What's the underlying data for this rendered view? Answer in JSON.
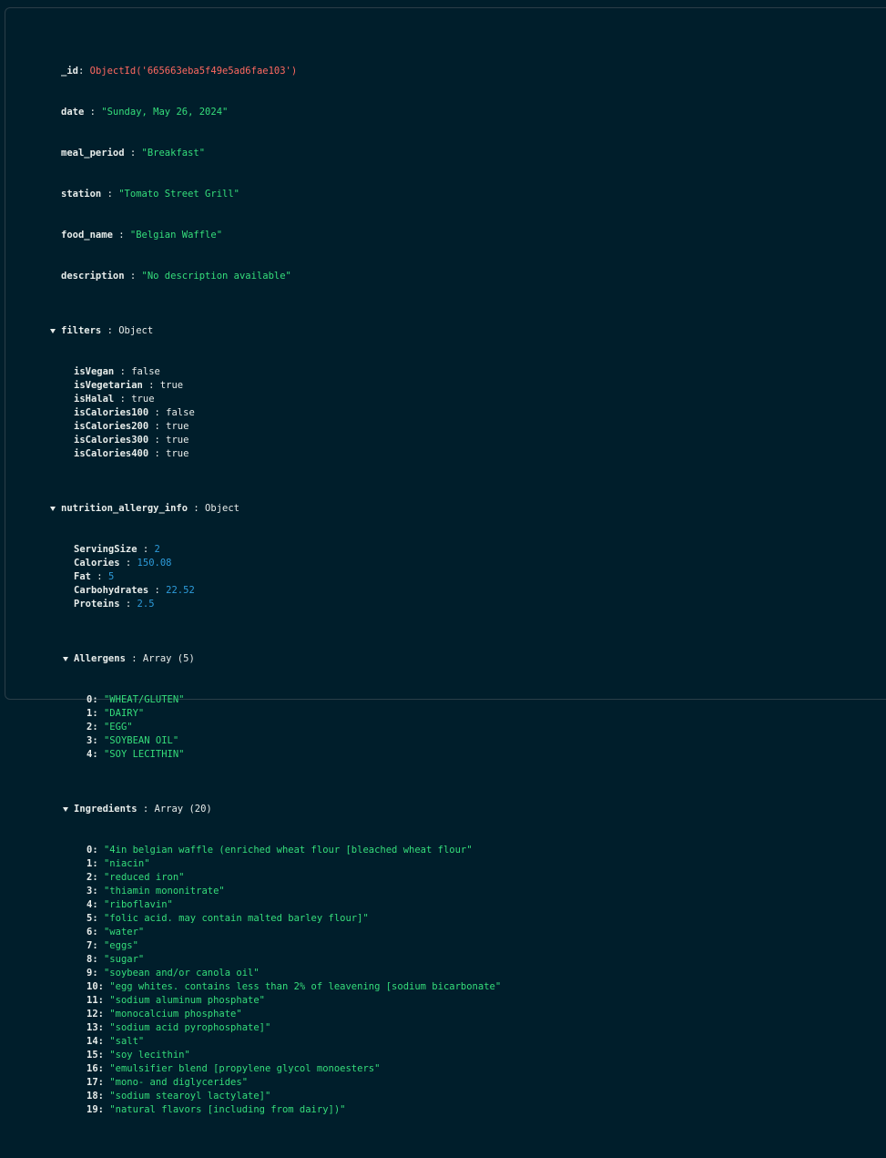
{
  "document": {
    "id_key": "_id",
    "id_value": "ObjectId('665663eba5f49e5ad6fae103')",
    "date": "\"Sunday, May 26, 2024\"",
    "meal_period": "\"Breakfast\"",
    "station": "\"Tomato Street Grill\"",
    "food_name": "\"Belgian Waffle\"",
    "description": "\"No description available\"",
    "filters": {
      "key": "filters",
      "type": "Object",
      "fields": [
        {
          "key": "isVegan",
          "value": "false"
        },
        {
          "key": "isVegetarian",
          "value": "true"
        },
        {
          "key": "isHalal",
          "value": "true"
        },
        {
          "key": "isCalories100",
          "value": "false"
        },
        {
          "key": "isCalories200",
          "value": "true"
        },
        {
          "key": "isCalories300",
          "value": "true"
        },
        {
          "key": "isCalories400",
          "value": "true"
        }
      ]
    },
    "nutrition": {
      "key": "nutrition_allergy_info",
      "type": "Object",
      "fields": [
        {
          "key": "ServingSize",
          "value": "2"
        },
        {
          "key": "Calories",
          "value": "150.08"
        },
        {
          "key": "Fat",
          "value": "5"
        },
        {
          "key": "Carbohydrates",
          "value": "22.52"
        },
        {
          "key": "Proteins",
          "value": "2.5"
        }
      ],
      "allergens": {
        "key": "Allergens",
        "type": "Array (5)",
        "items": [
          "\"WHEAT/GLUTEN\"",
          "\"DAIRY\"",
          "\"EGG\"",
          "\"SOYBEAN OIL\"",
          "\"SOY LECITHIN\""
        ]
      },
      "ingredients": {
        "key": "Ingredients",
        "type": "Array (20)",
        "items": [
          "\"4in belgian waffle (enriched wheat flour [bleached wheat flour\"",
          "\"niacin\"",
          "\"reduced iron\"",
          "\"thiamin mononitrate\"",
          "\"riboflavin\"",
          "\"folic acid. may contain malted barley flour]\"",
          "\"water\"",
          "\"eggs\"",
          "\"sugar\"",
          "\"soybean and/or canola oil\"",
          "\"egg whites. contains less than 2% of leavening [sodium bicarbonate\"",
          "\"sodium aluminum phosphate\"",
          "\"monocalcium phosphate\"",
          "\"sodium acid pyrophosphate]\"",
          "\"salt\"",
          "\"soy lecithin\"",
          "\"emulsifier blend [propylene glycol monoesters\"",
          "\"mono- and diglycerides\"",
          "\"sodium stearoyl lactylate]\"",
          "\"natural flavors [including from dairy])\""
        ]
      }
    }
  }
}
